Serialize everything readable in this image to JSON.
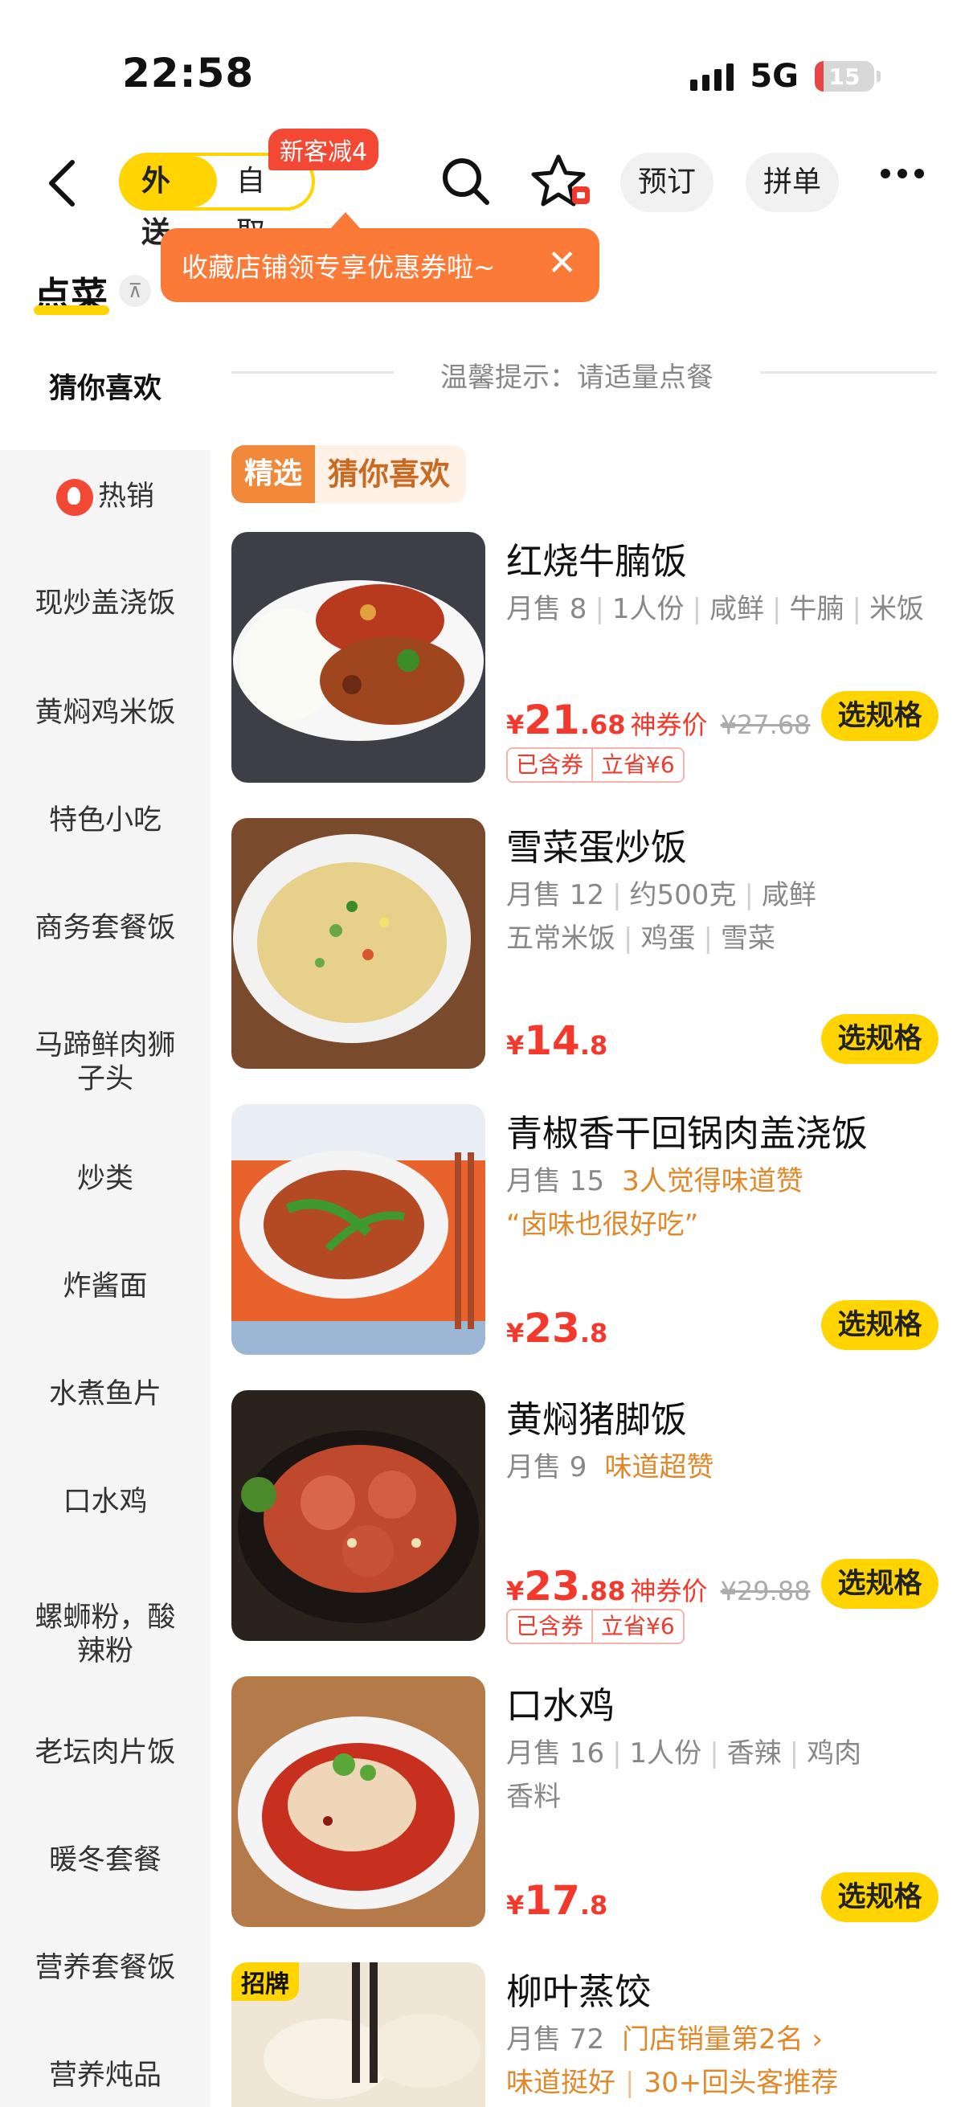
{
  "status_bar": {
    "time": "22:58",
    "network": "5G",
    "battery": "15",
    "battery_fraction": 0.15
  },
  "nav": {
    "mode_delivery": "外送",
    "mode_pickup": "自取",
    "promo_badge": "新客减4",
    "reserve_label": "预订",
    "group_order_label": "拼单"
  },
  "tabs": {
    "order": "点菜"
  },
  "tooltip": {
    "text": "收藏店铺领专享优惠券啦~",
    "close": "✕"
  },
  "notice": "温馨提示：请适量点餐",
  "section_tag": {
    "left": "精选",
    "right": "猜你喜欢"
  },
  "sidebar": {
    "items": [
      "猜你喜欢",
      "热销",
      "现炒盖浇饭",
      "黄焖鸡米饭",
      "特色小吃",
      "商务套餐饭",
      "马蹄鲜肉狮\n子头",
      "炒类",
      "炸酱面",
      "水煮鱼片",
      "口水鸡",
      "螺蛳粉，酸\n辣粉",
      "老坛肉片饭",
      "暖冬套餐",
      "营养套餐饭",
      "营养炖品"
    ]
  },
  "spec_label": "选规格",
  "dishes": [
    {
      "name": "红烧牛腩饭",
      "sales": "月售 8",
      "tags": [
        "1人份",
        "咸鲜",
        "牛腩",
        "米饭"
      ],
      "price_int": "21",
      "price_dec": ".68",
      "price_note": "神券价",
      "orig_price": "¥27.68",
      "coupon": [
        "已含券",
        "立省¥6"
      ]
    },
    {
      "name": "雪菜蛋炒饭",
      "sales": "月售 12",
      "tags": [
        "约500克",
        "咸鲜"
      ],
      "tags2": [
        "五常米饭",
        "鸡蛋",
        "雪菜"
      ],
      "price_int": "14",
      "price_dec": ".8"
    },
    {
      "name": "青椒香干回锅肉盖浇饭",
      "sales": "月售 15",
      "highlight": "3人觉得味道赞",
      "quote": "“卤味也很好吃”",
      "price_int": "23",
      "price_dec": ".8"
    },
    {
      "name": "黄焖猪脚饭",
      "sales": "月售 9",
      "highlight": "味道超赞",
      "price_int": "23",
      "price_dec": ".88",
      "price_note": "神券价",
      "orig_price": "¥29.88",
      "coupon": [
        "已含券",
        "立省¥6"
      ]
    },
    {
      "name": "口水鸡",
      "sales": "月售 16",
      "tags": [
        "1人份",
        "香辣",
        "鸡肉"
      ],
      "tags2_text": "香料",
      "price_int": "17",
      "price_dec": ".8"
    },
    {
      "name": "柳叶蒸饺",
      "badge": "招牌",
      "sales": "月售 72",
      "highlight": "门店销量第2名 ›",
      "line2_a": "味道挺好",
      "line2_b": "30+回头客推荐"
    }
  ],
  "currency": "¥",
  "colors": {
    "accent": "#ffd400",
    "price": "#f2392b",
    "tooltip": "#fb7a38",
    "badge": "#f24834"
  }
}
